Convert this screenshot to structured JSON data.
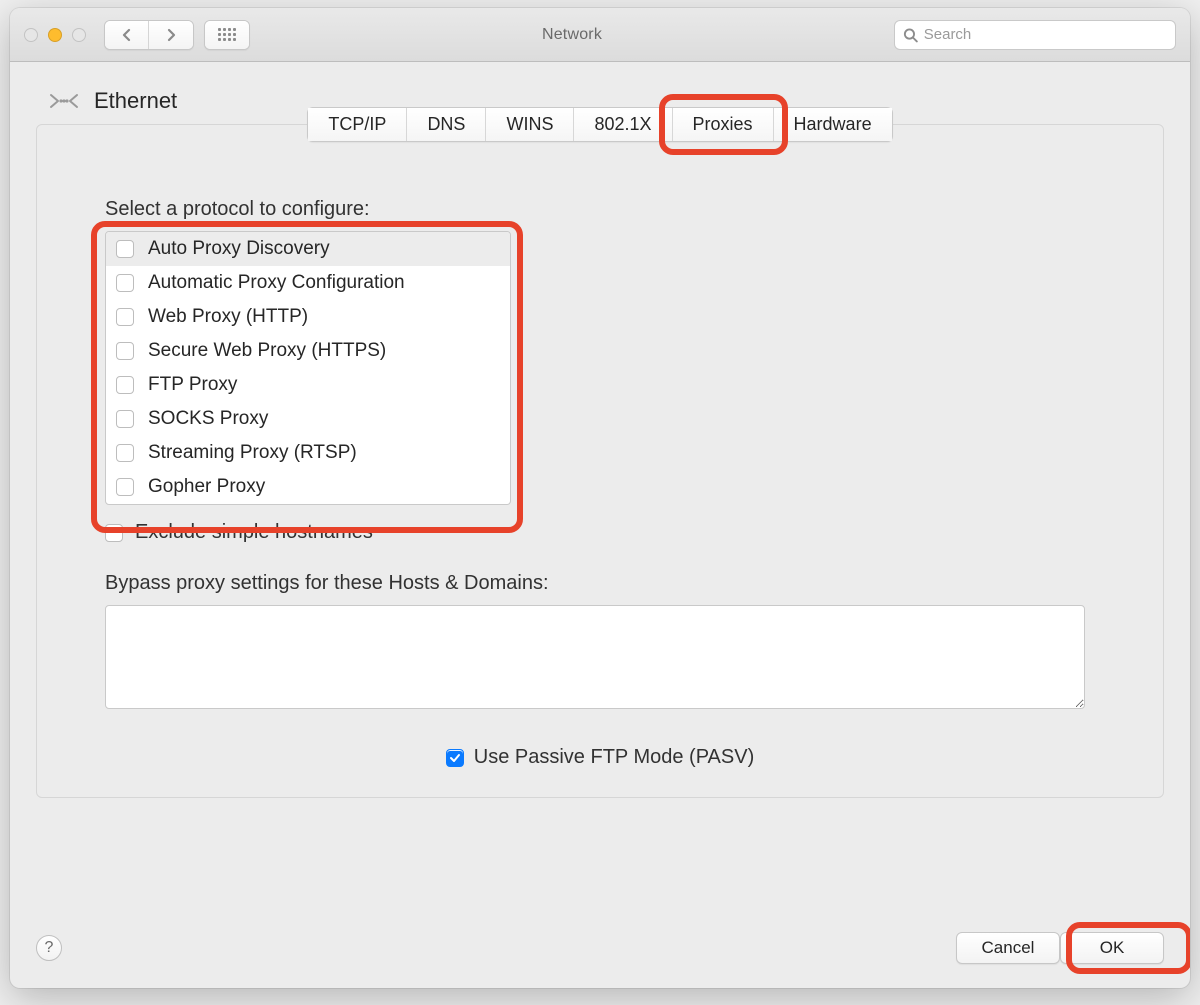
{
  "window": {
    "title": "Network"
  },
  "search": {
    "placeholder": "Search"
  },
  "heading": {
    "title": "Ethernet"
  },
  "tabs": [
    {
      "label": "TCP/IP"
    },
    {
      "label": "DNS"
    },
    {
      "label": "WINS"
    },
    {
      "label": "802.1X"
    },
    {
      "label": "Proxies",
      "active": true
    },
    {
      "label": "Hardware"
    }
  ],
  "proxies": {
    "section_label": "Select a protocol to configure:",
    "protocols": [
      {
        "label": "Auto Proxy Discovery",
        "checked": false,
        "selected": true
      },
      {
        "label": "Automatic Proxy Configuration",
        "checked": false
      },
      {
        "label": "Web Proxy (HTTP)",
        "checked": false
      },
      {
        "label": "Secure Web Proxy (HTTPS)",
        "checked": false
      },
      {
        "label": "FTP Proxy",
        "checked": false
      },
      {
        "label": "SOCKS Proxy",
        "checked": false
      },
      {
        "label": "Streaming Proxy (RTSP)",
        "checked": false
      },
      {
        "label": "Gopher Proxy",
        "checked": false
      }
    ],
    "exclude_label": "Exclude simple hostnames",
    "exclude_checked": false,
    "bypass_label": "Bypass proxy settings for these Hosts & Domains:",
    "bypass_value": "",
    "pasv_label": "Use Passive FTP Mode (PASV)",
    "pasv_checked": true
  },
  "footer": {
    "cancel": "Cancel",
    "ok": "OK"
  }
}
